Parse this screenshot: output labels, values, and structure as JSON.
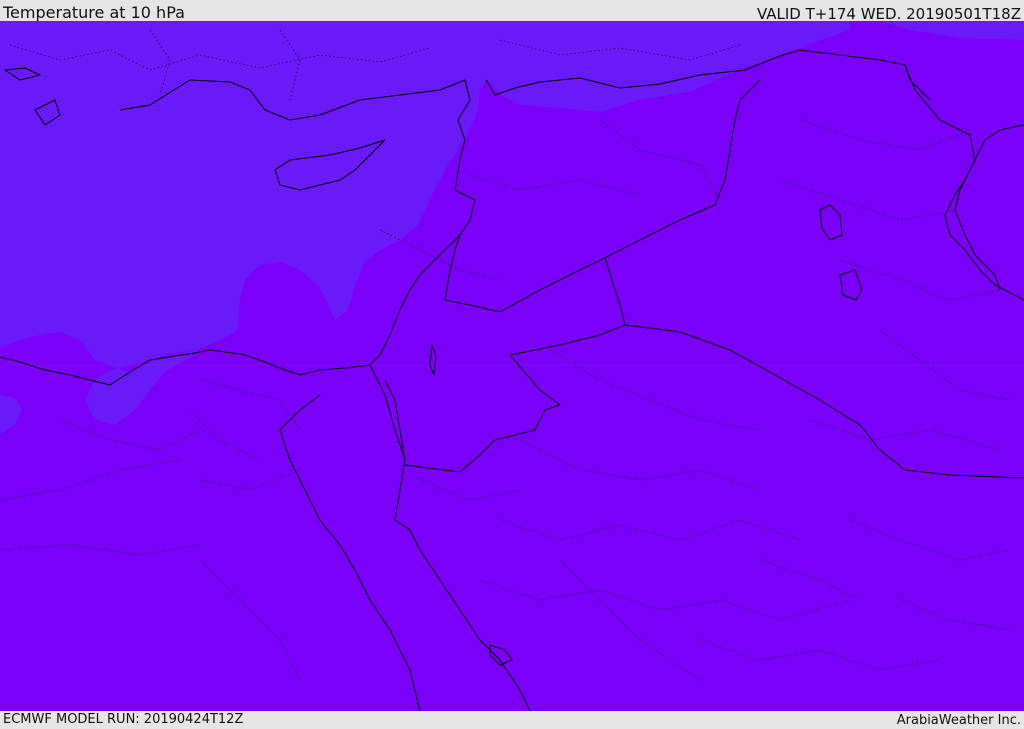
{
  "header": {
    "title": "Temperature at 10 hPa",
    "valid_time": "VALID T+174 WED. 20190501T18Z"
  },
  "footer": {
    "model_run": "ECMWF MODEL RUN: 20190424T12Z",
    "brand": "ArabiaWeather Inc."
  },
  "map": {
    "field": "temperature",
    "level": "10 hPa",
    "colors": {
      "warm_field": "#7a00fa",
      "cool_field": "#6a1af8",
      "coastline": "#000000",
      "border": "#000000"
    }
  }
}
